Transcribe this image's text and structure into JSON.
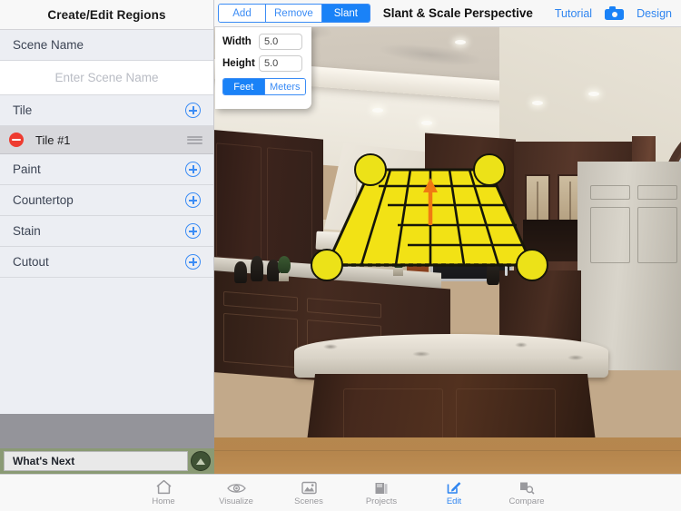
{
  "sidebar": {
    "title": "Create/Edit Regions",
    "scene_name_label": "Scene Name",
    "scene_name_value": "",
    "scene_name_placeholder": "Enter Scene Name",
    "sections": [
      {
        "label": "Tile",
        "add_icon": "plus-circle-icon"
      },
      {
        "label": "Paint",
        "add_icon": "plus-circle-icon"
      },
      {
        "label": "Countertop",
        "add_icon": "plus-circle-icon"
      },
      {
        "label": "Stain",
        "add_icon": "plus-circle-icon"
      },
      {
        "label": "Cutout",
        "add_icon": "plus-circle-icon"
      }
    ],
    "tile_items": [
      {
        "label": "Tile #1",
        "delete_icon": "minus-circle-icon",
        "reorder_icon": "grip-handle-icon"
      }
    ],
    "whats_next": {
      "label": "What's Next",
      "button_icon": "chevron-up-circle-icon"
    }
  },
  "topbar": {
    "segments": [
      {
        "label": "Add",
        "active": false
      },
      {
        "label": "Remove",
        "active": false
      },
      {
        "label": "Slant",
        "active": true
      }
    ],
    "title": "Slant & Scale Perspective",
    "tutorial_label": "Tutorial",
    "camera_icon": "camera-icon",
    "design_label": "Design"
  },
  "popup": {
    "width_label": "Width",
    "width_value": "5.0",
    "height_label": "Height",
    "height_value": "5.0",
    "units": [
      {
        "label": "Feet",
        "active": true
      },
      {
        "label": "Meters",
        "active": false
      }
    ]
  },
  "canvas": {
    "region_fill": "#f2e215",
    "region_stroke": "#1a1a1a",
    "handle_fill": "#ece218",
    "direction_arrow_color": "#f07a12",
    "grid_cols": 6,
    "grid_rows": 5
  },
  "tabbar": {
    "tabs": [
      {
        "label": "Home",
        "icon": "home-icon",
        "active": false
      },
      {
        "label": "Visualize",
        "icon": "eye-icon",
        "active": false
      },
      {
        "label": "Scenes",
        "icon": "photo-icon",
        "active": false
      },
      {
        "label": "Projects",
        "icon": "folder-icon",
        "active": false
      },
      {
        "label": "Edit",
        "icon": "pencil-square-icon",
        "active": true
      },
      {
        "label": "Compare",
        "icon": "compare-icon",
        "active": false
      }
    ]
  },
  "colors": {
    "accent_blue": "#1a82f7",
    "delete_red": "#ee3b30",
    "whats_next_green": "#8a9a74",
    "sidebar_bg": "#eceef3"
  }
}
